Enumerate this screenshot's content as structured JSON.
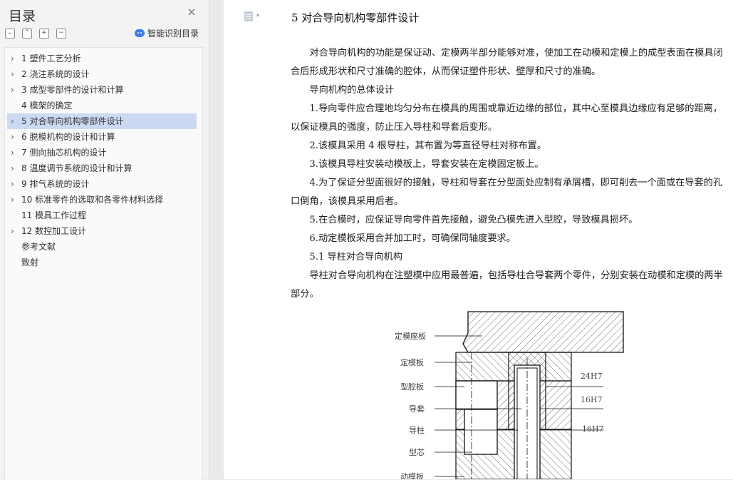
{
  "toc": {
    "title": "目录",
    "smart_label": "智能识别目录",
    "items": [
      {
        "label": "1    塑件工艺分析",
        "has_children": true,
        "active": false
      },
      {
        "label": "2  浇注系统的设计",
        "has_children": true,
        "active": false
      },
      {
        "label": "3  成型零部件的设计和计算",
        "has_children": true,
        "active": false
      },
      {
        "label": "4    模架的确定",
        "has_children": false,
        "active": false
      },
      {
        "label": "5    对合导向机构零部件设计",
        "has_children": true,
        "active": true
      },
      {
        "label": "6    脱模机构的设计和计算",
        "has_children": true,
        "active": false
      },
      {
        "label": "7    侧向抽芯机构的设计",
        "has_children": true,
        "active": false
      },
      {
        "label": "8  温度调节系统的设计和计算",
        "has_children": true,
        "active": false
      },
      {
        "label": "9    排气系统的设计",
        "has_children": true,
        "active": false
      },
      {
        "label": "10    标准零件的选取和各零件材料选择",
        "has_children": true,
        "active": false
      },
      {
        "label": "11    模具工作过程",
        "has_children": false,
        "active": false
      },
      {
        "label": "12  数控加工设计",
        "has_children": true,
        "active": false
      },
      {
        "label": "参考文献",
        "has_children": false,
        "active": false,
        "flush": true
      },
      {
        "label": "致射",
        "has_children": false,
        "active": false,
        "flush": true
      }
    ]
  },
  "document": {
    "heading": "5    对合导向机构零部件设计",
    "paragraphs": [
      "对合导向机构的功能是保证动、定模两半部分能够对准，使加工在动模和定模上的成型表面在模具闭合后形成形状和尺寸准确的腔体，从而保证塑件形状、壁厚和尺寸的准确。",
      "导向机构的总体设计",
      "1.导向零件应合理地均匀分布在模具的周围或靠近边缘的部位，其中心至模具边缘应有足够的距离，以保证模具的强度，防止压入导柱和导套后变形。",
      "2.该模具采用 4 根导柱，其布置为等直径导柱对称布置。",
      "3.该模具导柱安装动模板上，导套安装在定模固定板上。",
      "4.为了保证分型面很好的接触，导柱和导套在分型面处应制有承屑槽，即可削去一个面或在导套的孔口倒角，该模具采用后者。",
      "5.在合模时，应保证导向零件首先接触，避免凸模先进入型腔，导致模具损坏。",
      "6.动定模板采用合并加工时，可确保同轴度要求。",
      "5.1 导柱对合导向机构",
      "导柱对合导向机构在注塑模中应用最普遍，包括导柱合导套两个零件，分别安装在动模和定模的两半部分。"
    ]
  },
  "figure": {
    "labels": [
      "定模座板",
      "定模板",
      "型腔板",
      "导套",
      "导柱",
      "型芯",
      "动模板"
    ],
    "dims": [
      "24H7",
      "16H7",
      "16H7"
    ]
  }
}
